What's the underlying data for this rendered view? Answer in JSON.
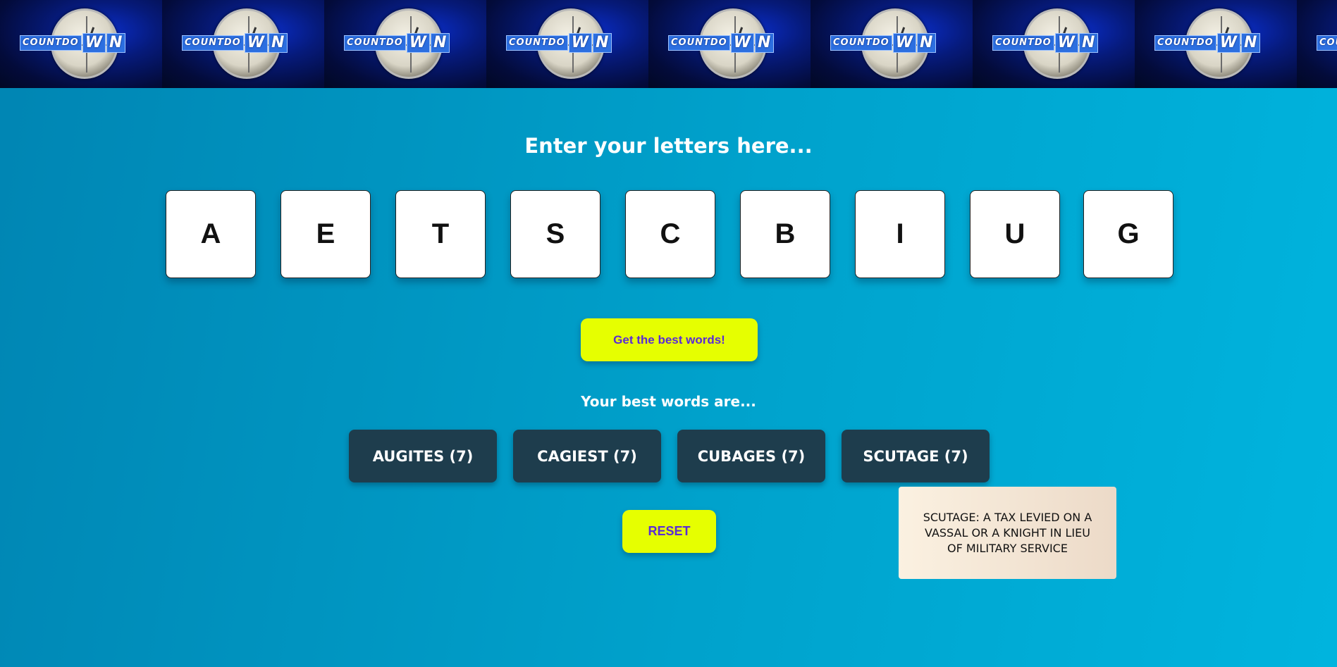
{
  "banner": {
    "logo_small": "COUNTDO",
    "logo_big_1": "W",
    "logo_big_2": "N",
    "tile_count": 9
  },
  "heading": "Enter your letters here...",
  "letters": [
    "A",
    "E",
    "T",
    "S",
    "C",
    "B",
    "I",
    "U",
    "G"
  ],
  "buttons": {
    "best_words": "Get the best words!",
    "reset": "RESET"
  },
  "results": {
    "heading": "Your best words are...",
    "words": [
      "AUGITES (7)",
      "CAGIEST (7)",
      "CUBAGES (7)",
      "SCUTAGE (7)"
    ]
  },
  "definition": "SCUTAGE: A TAX LEVIED ON A VASSAL OR A KNIGHT IN LIEU OF MILITARY SERVICE",
  "colors": {
    "accent_button": "#e6ff00",
    "accent_button_text": "#5a2bd6",
    "word_chip": "#1e3d4d",
    "banner_bg": "#03092e"
  }
}
